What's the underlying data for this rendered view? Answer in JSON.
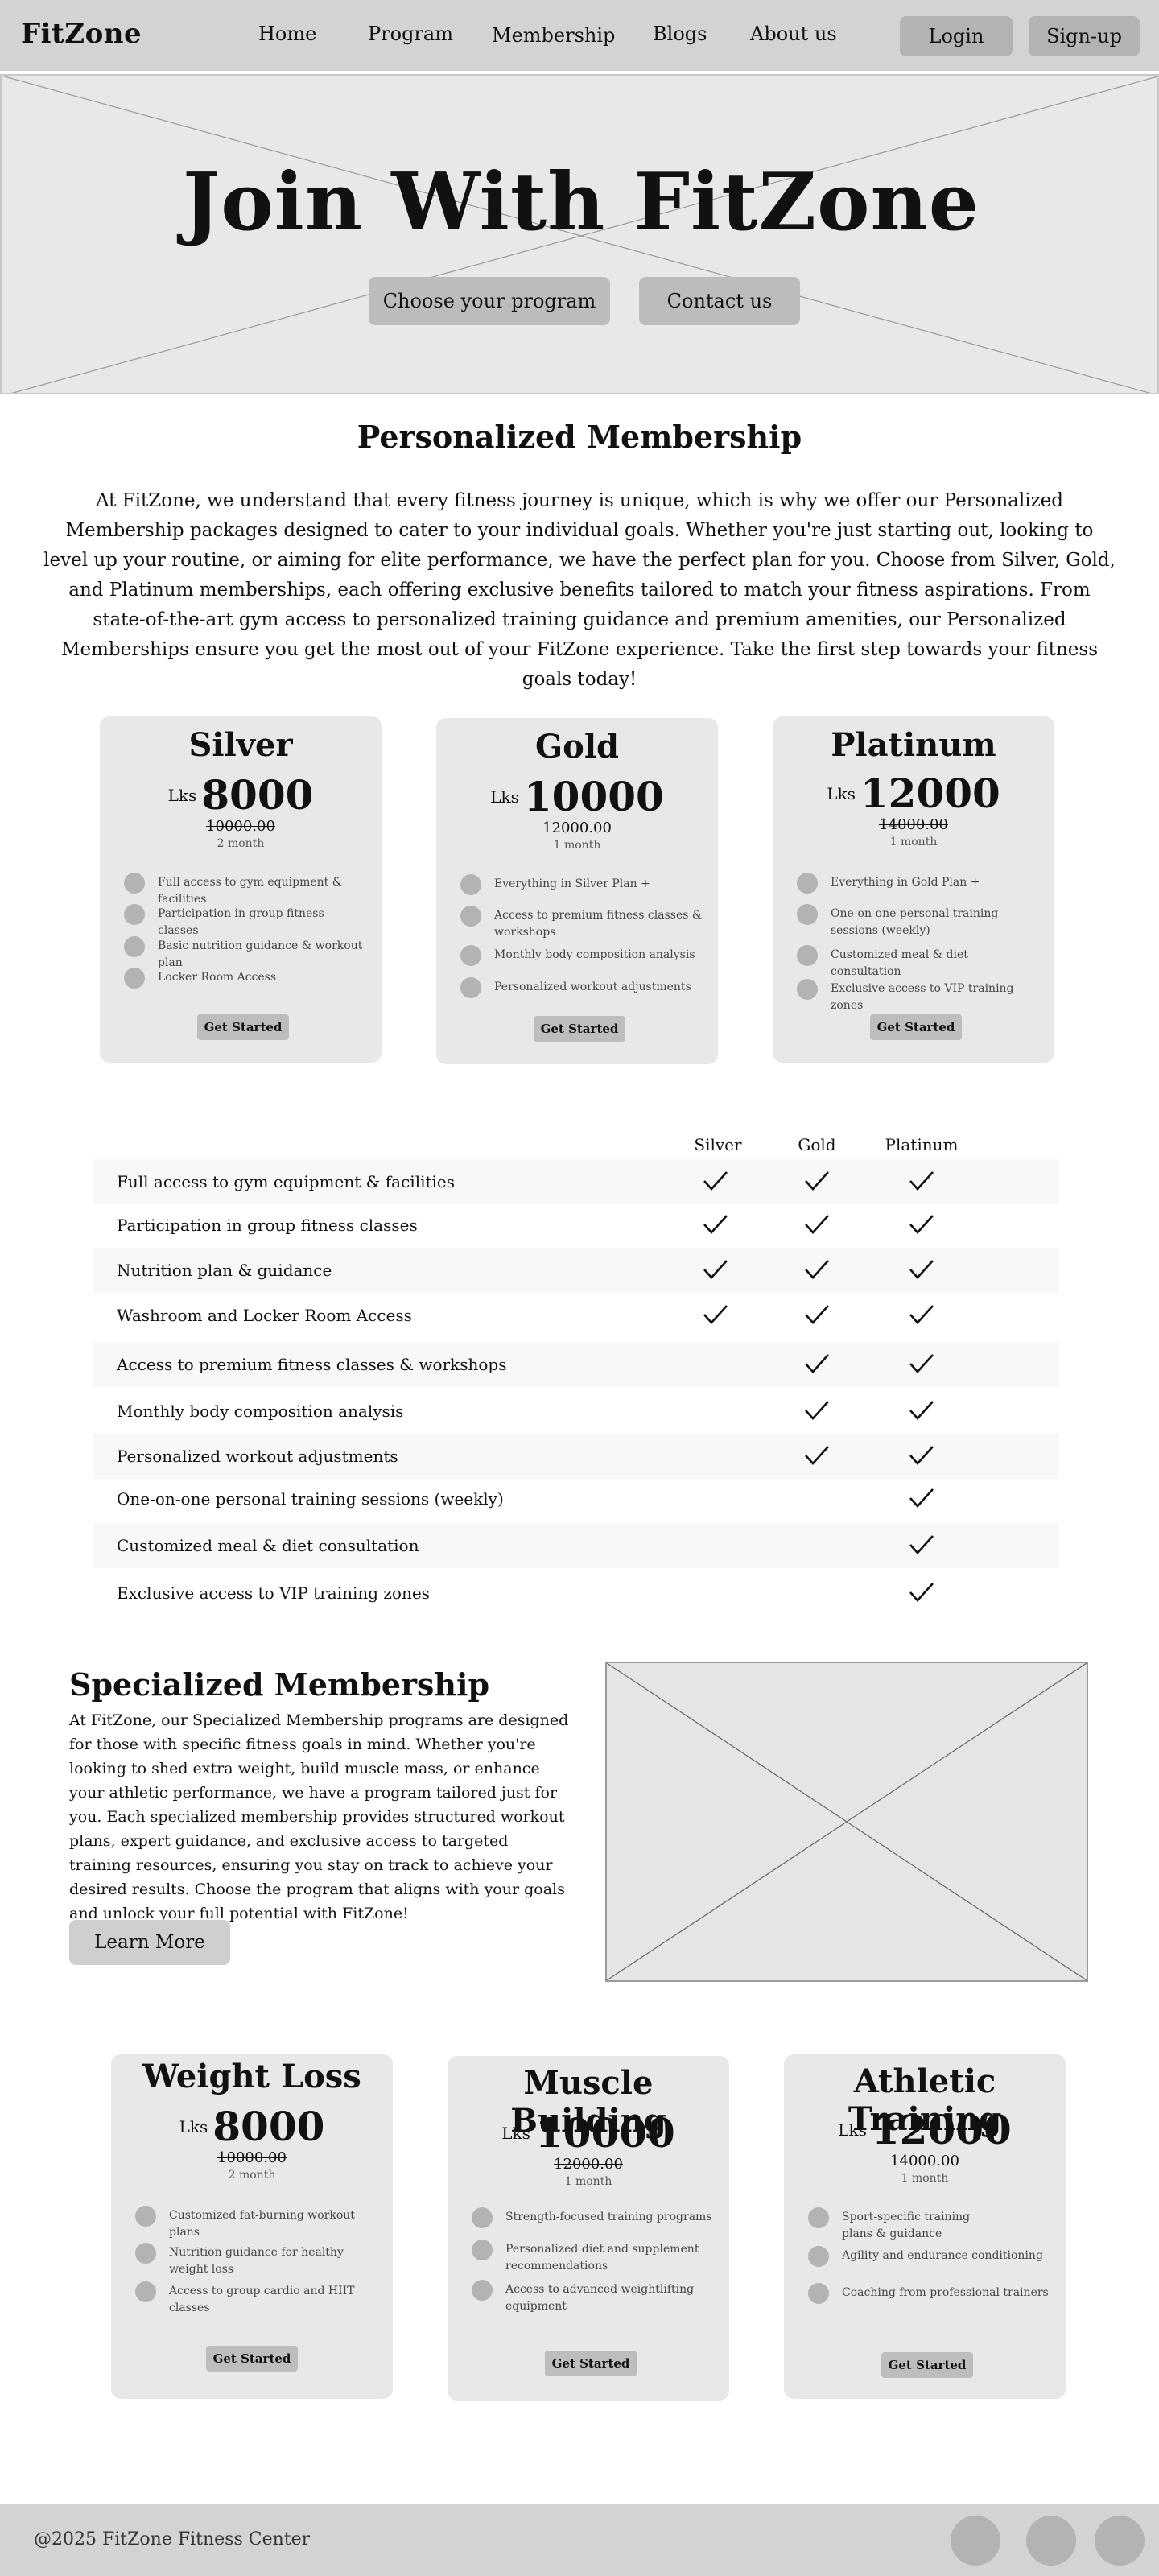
{
  "nav": {
    "logo": "FitZone",
    "links": [
      "Home",
      "Program",
      "Membership",
      "Blogs",
      "About us"
    ],
    "login": "Login",
    "signup": "Sign-up"
  },
  "hero": {
    "title": "Join With FitZone",
    "btn_program": "Choose your program",
    "btn_contact": "Contact us"
  },
  "personalized": {
    "title": "Personalized Membership",
    "intro": "At FitZone, we understand that every fitness journey is unique, which is why we offer our Personalized Membership packages designed to cater to your individual goals. Whether you're just starting out, looking to level up your routine, or aiming for elite performance, we have the perfect plan for you. Choose from Silver, Gold, and Platinum memberships, each offering exclusive benefits tailored to match your fitness aspirations. From state-of-the-art gym access to personalized training guidance and premium amenities, our Personalized Memberships ensure you get the most out of your FitZone experience. Take the first step towards your fitness goals today!",
    "plans": [
      {
        "name": "Silver",
        "currency": "Lks",
        "price": "8000",
        "old_price": "10000.00",
        "period": "2 month",
        "features": [
          "Full access to gym equipment & facilities",
          "Participation in group fitness classes",
          "Basic nutrition guidance & workout plan",
          "Locker Room Access"
        ],
        "cta": "Get Started"
      },
      {
        "name": "Gold",
        "currency": "Lks",
        "price": "10000",
        "old_price": "12000.00",
        "period": "1 month",
        "features": [
          "Everything in Silver Plan +",
          "Access to premium fitness classes & workshops",
          "Monthly body composition analysis",
          "Personalized workout adjustments"
        ],
        "cta": "Get Started"
      },
      {
        "name": "Platinum",
        "currency": "Lks",
        "price": "12000",
        "old_price": "14000.00",
        "period": "1 month",
        "features": [
          "Everything in Gold Plan +",
          "One-on-one personal training sessions (weekly)",
          "Customized meal & diet consultation",
          "Exclusive access to VIP training zones"
        ],
        "cta": "Get Started"
      }
    ]
  },
  "comparison": {
    "columns": [
      "Silver",
      "Gold",
      "Platinum"
    ],
    "rows": [
      {
        "label": "Full access to gym equipment & facilities",
        "checks": [
          true,
          true,
          true
        ]
      },
      {
        "label": "Participation in group fitness classes",
        "checks": [
          true,
          true,
          true
        ]
      },
      {
        "label": "Nutrition plan & guidance",
        "checks": [
          true,
          true,
          true
        ]
      },
      {
        "label": "Washroom and Locker Room Access",
        "checks": [
          true,
          true,
          true
        ]
      },
      {
        "label": "Access to premium fitness classes & workshops",
        "checks": [
          false,
          true,
          true
        ]
      },
      {
        "label": "Monthly body composition analysis",
        "checks": [
          false,
          true,
          true
        ]
      },
      {
        "label": "Personalized workout adjustments",
        "checks": [
          false,
          true,
          true
        ]
      },
      {
        "label": "One-on-one personal training sessions (weekly)",
        "checks": [
          false,
          false,
          true
        ]
      },
      {
        "label": "Customized meal & diet consultation",
        "checks": [
          false,
          false,
          true
        ]
      },
      {
        "label": "Exclusive access to VIP training zones",
        "checks": [
          false,
          false,
          true
        ]
      }
    ]
  },
  "specialized": {
    "title": "Specialized Membership",
    "text": "At FitZone, our Specialized Membership programs are designed for those with specific fitness goals in mind. Whether you're looking to shed extra weight, build muscle mass, or enhance your athletic performance, we have a program tailored just for you. Each specialized membership provides structured workout plans, expert guidance, and exclusive access to targeted training resources, ensuring you stay on track to achieve your desired results. Choose the program that aligns with your goals and unlock your full potential with FitZone!",
    "cta": "Learn More",
    "plans": [
      {
        "name": "Weight Loss",
        "currency": "Lks",
        "price": "8000",
        "old_price": "10000.00",
        "period": "2 month",
        "features": [
          "Customized fat-burning workout plans",
          "Nutrition guidance for healthy weight loss",
          "Access to group cardio and HIIT classes"
        ],
        "cta": "Get Started"
      },
      {
        "name": "Muscle Building",
        "currency": "Lks",
        "price": "10000",
        "old_price": "12000.00",
        "period": "1 month",
        "features": [
          "Strength-focused training programs",
          "Personalized diet and supplement recommendations",
          "Access to advanced weightlifting equipment"
        ],
        "cta": "Get Started"
      },
      {
        "name": "Athletic Training",
        "currency": "Lks",
        "price": "12000",
        "old_price": "14000.00",
        "period": "1 month",
        "features": [
          "Sport-specific training plans & guidance",
          "Agility and endurance conditioning",
          "Coaching from professional trainers"
        ],
        "cta": "Get Started"
      }
    ]
  },
  "footer": {
    "copyright": "@2025 FitZone Fitness Center"
  }
}
